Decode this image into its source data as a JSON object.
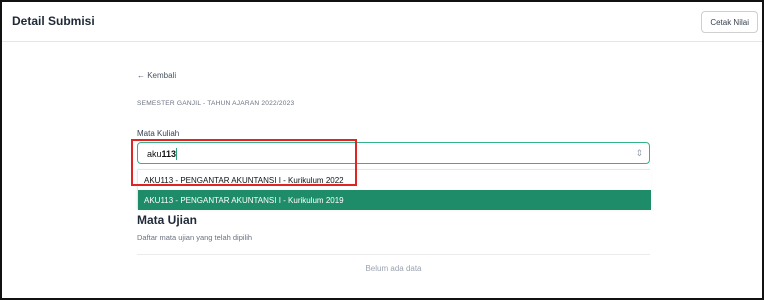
{
  "header": {
    "title": "Detail Submisi",
    "print_label": "Cetak Nilai"
  },
  "nav": {
    "back_label": "← Kembali"
  },
  "semester": {
    "label": "SEMESTER GANJIL - TAHUN AJARAN 2022/2023"
  },
  "course_field": {
    "label": "Mata Kuliah",
    "value_prefix": "aku",
    "value_bold": "113",
    "chevron": "⇕"
  },
  "dropdown": {
    "options": [
      {
        "label": "AKU113 - PENGANTAR AKUNTANSI I - Kurikulum 2022"
      },
      {
        "label": "AKU113 - PENGANTAR AKUNTANSI I - Kurikulum 2019"
      }
    ]
  },
  "exam": {
    "title": "Mata Ujian",
    "subtitle": "Daftar mata ujian yang telah dipilih",
    "empty_text": "Belum ada data"
  },
  "colors": {
    "accent": "#1e8c68",
    "focus_border": "#34b28a",
    "annotation_red": "#e02424"
  }
}
